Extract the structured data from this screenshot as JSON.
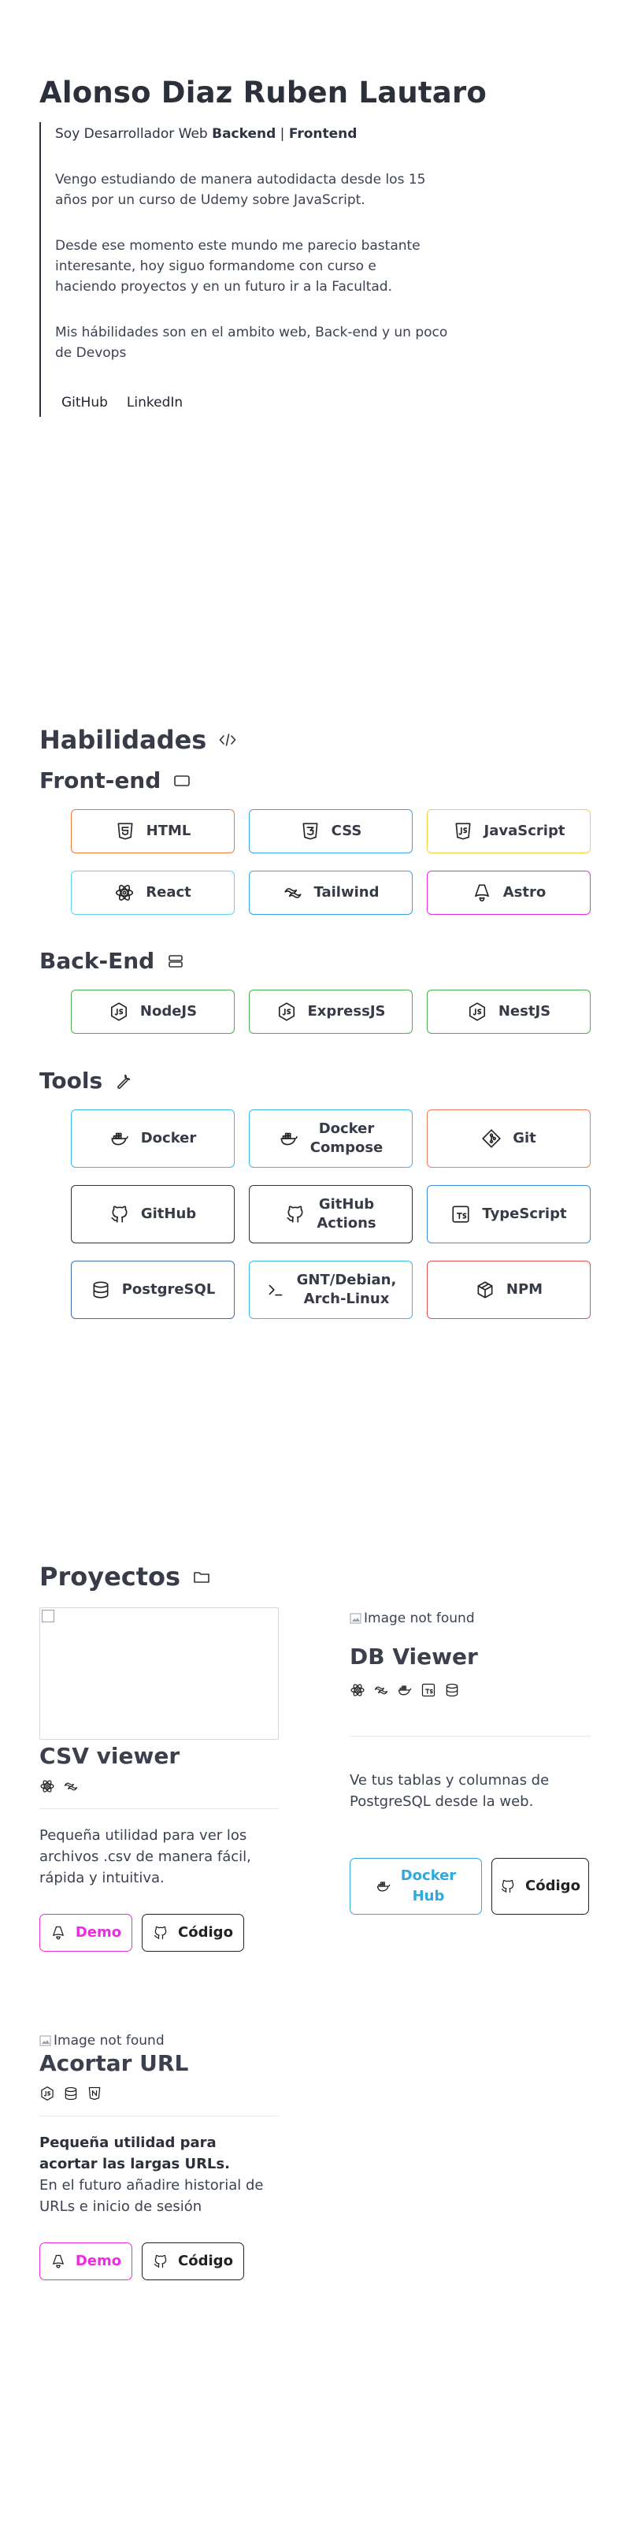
{
  "hero": {
    "name": "Alonso Diaz Ruben Lautaro",
    "role_prefix": "Soy Desarrollador Web ",
    "role_backend": "Backend",
    "role_sep": " | ",
    "role_frontend": "Frontend",
    "p1": "Vengo estudiando de manera autodidacta desde los 15 años por un curso de Udemy sobre JavaScript.",
    "p2": "Desde ese momento este mundo me parecio bastante interesante, hoy siguo formandome con curso e haciendo proyectos y en un futuro ir a la Facultad.",
    "p3": "Mis hábilidades son en el ambito web, Back-end y un poco de Devops",
    "links": [
      "GitHub",
      "LinkedIn"
    ]
  },
  "skills": {
    "title": "Habilidades",
    "frontend": {
      "title": "Front-end",
      "items": [
        {
          "label": "HTML",
          "icon": "html5-icon",
          "color": "#f07a3c"
        },
        {
          "label": "CSS",
          "icon": "css3-icon",
          "color": "#3aa4e8"
        },
        {
          "label": "JavaScript",
          "icon": "js-icon",
          "color": "#f2d13c"
        },
        {
          "label": "React",
          "icon": "react-icon",
          "color": "#5fd3f0"
        },
        {
          "label": "Tailwind",
          "icon": "tailwind-icon",
          "color": "#3aa4e8"
        },
        {
          "label": "Astro",
          "icon": "astro-icon",
          "color": "#ee2be0"
        }
      ]
    },
    "backend": {
      "title": "Back-End",
      "items": [
        {
          "label": "NodeJS",
          "icon": "nodejs-icon",
          "color": "#4caf50"
        },
        {
          "label": "ExpressJS",
          "icon": "nodejs-icon",
          "color": "#4caf50"
        },
        {
          "label": "NestJS",
          "icon": "nodejs-icon",
          "color": "#4caf50"
        }
      ]
    },
    "tools": {
      "title": "Tools",
      "items": [
        {
          "label": "Docker",
          "icon": "docker-icon",
          "color": "#3ab8e8"
        },
        {
          "label": "Docker\nCompose",
          "icon": "docker-icon",
          "color": "#3ab8e8"
        },
        {
          "label": "Git",
          "icon": "git-icon",
          "color": "#f07a5a"
        },
        {
          "label": "GitHub",
          "icon": "github-icon",
          "color": "#333333"
        },
        {
          "label": "GitHub\nActions",
          "icon": "github-icon",
          "color": "#333333"
        },
        {
          "label": "TypeScript",
          "icon": "typescript-icon",
          "color": "#3a8fd8"
        },
        {
          "label": "PostgreSQL",
          "icon": "database-icon",
          "color": "#3a6fb0"
        },
        {
          "label": "GNT/Debian,\nArch-Linux",
          "icon": "terminal-icon",
          "color": "#3ab8e8"
        },
        {
          "label": "NPM",
          "icon": "package-icon",
          "color": "#e05050"
        }
      ]
    }
  },
  "projects": {
    "title": "Proyectos",
    "image_alt": "Image not found",
    "items": [
      {
        "title": "CSV viewer",
        "tech_icons": [
          "react-icon",
          "tailwind-icon"
        ],
        "description": "Pequeña utilidad para ver los archivos .csv de manera fácil, rápida y intuitiva.",
        "buttons": [
          {
            "label": "Demo",
            "icon": "astro-icon",
            "color": "#ee2be0"
          },
          {
            "label": "Código",
            "icon": "github-icon",
            "color": "#222222"
          }
        ]
      },
      {
        "title": "DB Viewer",
        "tech_icons": [
          "react-icon",
          "tailwind-icon",
          "docker-icon",
          "typescript-icon",
          "database-icon"
        ],
        "description": "Ve tus tablas y columnas de PostgreSQL desde la web.",
        "buttons": [
          {
            "label": "Docker\nHub",
            "icon": "docker-icon",
            "color": "#2fa8e0"
          },
          {
            "label": "Código",
            "icon": "github-icon",
            "color": "#222222"
          }
        ]
      },
      {
        "title": "Acortar URL",
        "tech_icons": [
          "nodejs-icon",
          "database-icon",
          "nestjs-icon"
        ],
        "description_bold": "Pequeña utilidad para acortar las largas URLs.",
        "description": "En el futuro añadire historial de URLs e inicio de sesión",
        "buttons": [
          {
            "label": "Demo",
            "icon": "astro-icon",
            "color": "#ee2be0"
          },
          {
            "label": "Código",
            "icon": "github-icon",
            "color": "#222222"
          }
        ]
      }
    ]
  }
}
